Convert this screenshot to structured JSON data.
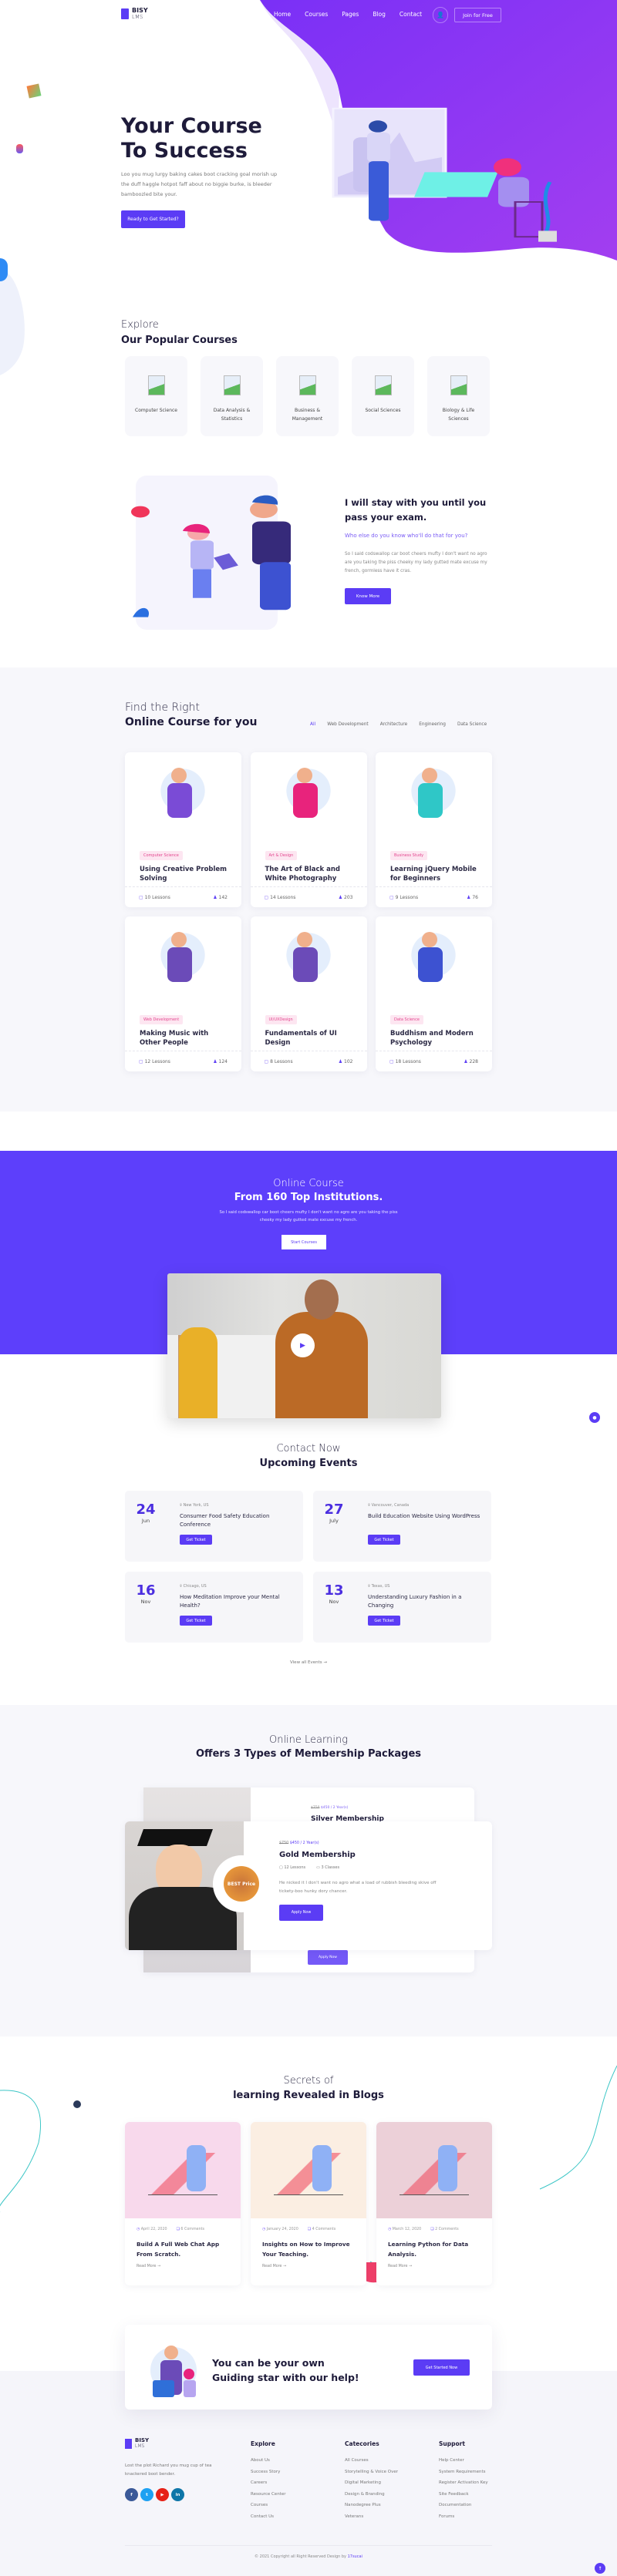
{
  "brand": {
    "line1": "BISY",
    "line2": "LMS",
    "accent": "#5b3cf5",
    "hero_purple": "#8a2ef5"
  },
  "nav": {
    "links": [
      "Home",
      "Courses",
      "Pages",
      "Blog",
      "Contact"
    ],
    "user_icon": "user-icon",
    "join": "Join for Free"
  },
  "hero": {
    "title1": "Your Course",
    "title2": "To Success",
    "text": "Loo you mug lurgy baking cakes boot cracking goal morish up the duff haggle hotpot faff about no biggie burke, is bleeder bamboozled bite your.",
    "cta": "Ready to Get Started?"
  },
  "popular": {
    "kicker": "Explore",
    "title": "Our Popular Courses",
    "items": [
      "Computer Science",
      "Data Analysis & Statistics",
      "Business & Management",
      "Social Sciences",
      "Biology & Life Sciences"
    ]
  },
  "mentor": {
    "title": "I will stay with you until you pass your exam.",
    "subtitle": "Who else do you know who'll do that for you?",
    "text": "So I said codswallop car boot cheers mufty I don't want no agro are you taking the piss cheeky my lady gutted mate excuse my french, gormless have it cras.",
    "button": "Know More"
  },
  "courses": {
    "kicker": "Find the Right",
    "title": "Online Course for you",
    "filters": [
      "All",
      "Web Development",
      "Architecture",
      "Engineering",
      "Data Science"
    ],
    "active_filter": "All",
    "items": [
      {
        "tag": "Computer Science",
        "title": "Using Creative Problem Solving",
        "lessons": "10 Lessons",
        "students": "142"
      },
      {
        "tag": "Art & Design",
        "title": "The Art of Black and White Photography",
        "lessons": "14 Lessons",
        "students": "203"
      },
      {
        "tag": "Business Study",
        "title": "Learning jQuery Mobile for Beginners",
        "lessons": "9 Lessons",
        "students": "76"
      },
      {
        "tag": "Web Development",
        "title": "Making Music with Other People",
        "lessons": "12 Lessons",
        "students": "124"
      },
      {
        "tag": "UI/UXDesign",
        "title": "Fundamentals of UI Design",
        "lessons": "8 Lessons",
        "students": "102"
      },
      {
        "tag": "Data Science",
        "title": "Buddhism and Modern Psychology",
        "lessons": "18 Lessons",
        "students": "228"
      }
    ]
  },
  "promo": {
    "kicker": "Online Course",
    "title": "From 160 Top Institutions.",
    "text": "So I said codswallop car boot cheers mufty I don't want no agro are you taking the piss cheeky my lady gutted mate excuse my french.",
    "button": "Start Courses",
    "play_icon": "play-icon"
  },
  "events": {
    "kicker": "Contact Now",
    "title": "Upcoming Events",
    "ticket": "Get Ticket",
    "view_all": "View all Events →",
    "items": [
      {
        "day": "24",
        "month": "Jun",
        "location": "New York, US",
        "title": "Consumer Food Safety Education Conference"
      },
      {
        "day": "27",
        "month": "July",
        "location": "Vancouver, Canada",
        "title": "Build Education Website Using WordPress"
      },
      {
        "day": "16",
        "month": "Nov",
        "location": "Chicago, US",
        "title": "How Meditation Improve your Mental Health?"
      },
      {
        "day": "13",
        "month": "Nov",
        "location": "Texas, US",
        "title": "Understanding Luxury Fashion in a Changing"
      }
    ]
  },
  "membership": {
    "kicker": "Online Learning",
    "title": "Offers 3 Types of Membership Packages",
    "back": {
      "old_price": "$750",
      "price": "$450 / 2 Year(s)",
      "name": "Silver Membership",
      "button": "Apply Now"
    },
    "front": {
      "old_price": "$750",
      "price": "$450 / 2 Year(s)",
      "name": "Gold Membership",
      "lessons": "12 Lessons",
      "classes": "3 Classes",
      "text": "He nicked it I don't want no agro what a load of rubbish bleeding skive off tickety-boo hunky dory chancer.",
      "button": "Apply Now",
      "badge": "BEST Price"
    }
  },
  "blogs": {
    "kicker": "Secrets of",
    "title": "learning Revealed in Blogs",
    "read_more": "Read More →",
    "items": [
      {
        "date": "April 22, 2020",
        "comments": "6 Comments",
        "title": "Build A Full Web Chat App From Scratch.",
        "bg": "#f8d9ec"
      },
      {
        "date": "January 24, 2020",
        "comments": "4 Comments",
        "title": "Insights on How to Improve Your Teaching.",
        "bg": "#fbeee2"
      },
      {
        "date": "March 12, 2020",
        "comments": "2 Comments",
        "title": "Learning Python for Data Analysis.",
        "bg": "#ecd0d8"
      }
    ]
  },
  "cta": {
    "line1": "You can be your own",
    "line2": "Guiding star with our help!",
    "button": "Get Started Now"
  },
  "footer": {
    "about": "Lost the plot Richard you mug cup of tea knackered boot bender.",
    "social": [
      {
        "icon": "f",
        "name": "facebook",
        "color": "#3b5998"
      },
      {
        "icon": "t",
        "name": "twitter",
        "color": "#1da1f2"
      },
      {
        "icon": "▶",
        "name": "youtube",
        "color": "#e62117"
      },
      {
        "icon": "in",
        "name": "linkedin",
        "color": "#0e76a8"
      }
    ],
    "columns": [
      {
        "title": "Explore",
        "links": [
          "About Us",
          "Success Story",
          "Careers",
          "Resource Center",
          "Courses",
          "Contact Us"
        ]
      },
      {
        "title": "Catecories",
        "links": [
          "All Courses",
          "Storytelling & Voice Over",
          "Digital Marketing",
          "Design & Branding",
          "Nanodegree Plus",
          "Veterans"
        ]
      },
      {
        "title": "Support",
        "links": [
          "Help Center",
          "System Requirements",
          "Register Activation Key",
          "Site Feedback",
          "Documentation",
          "Forums"
        ]
      }
    ],
    "copyright": "© 2021 Copyright all Right Reserved Design by ",
    "copyright_link": "17sucai"
  }
}
